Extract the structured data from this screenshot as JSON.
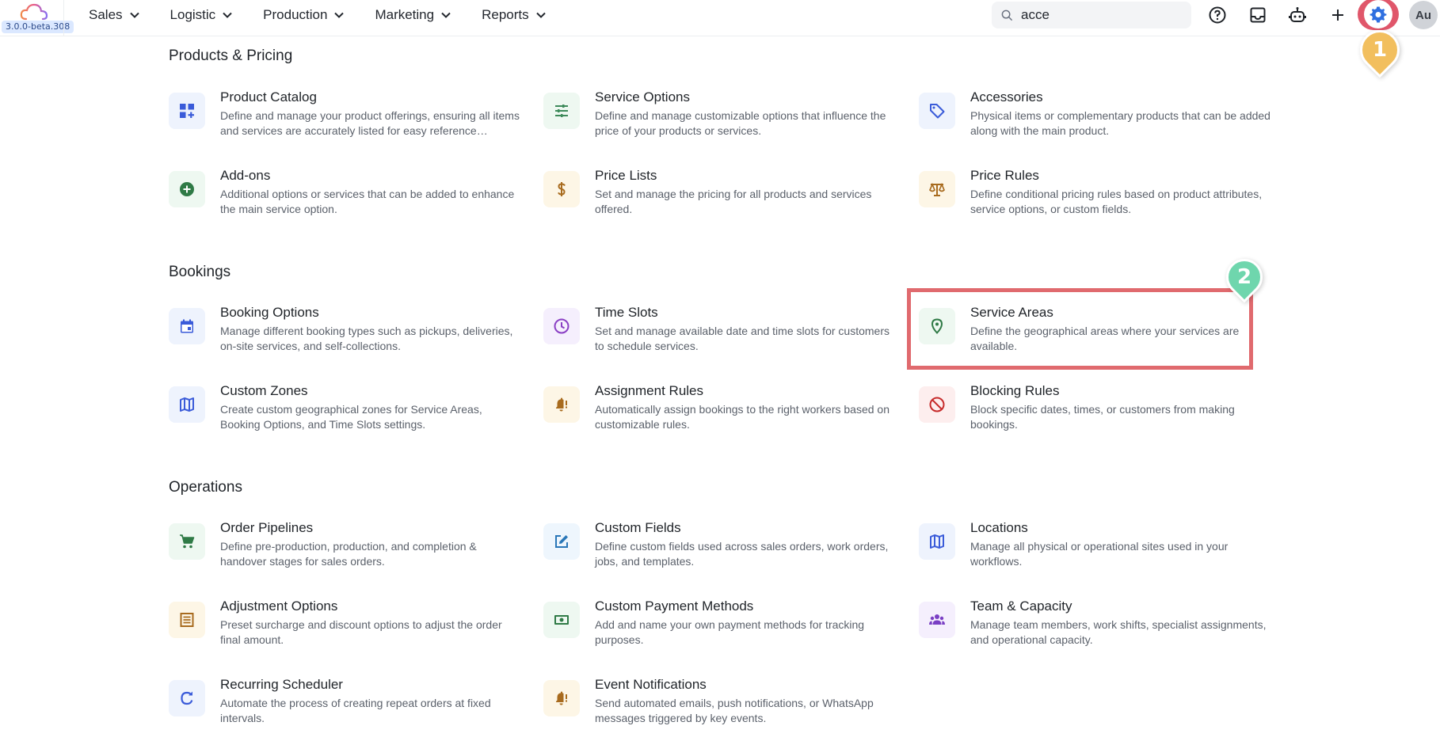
{
  "header": {
    "version": "3.0.0-beta.308",
    "nav": [
      "Sales",
      "Logistic",
      "Production",
      "Marketing",
      "Reports"
    ],
    "search_value": "acce",
    "avatar_initials": "Au",
    "accent": "#2f6fe0"
  },
  "markers": {
    "first": "1",
    "second": "2"
  },
  "sections": [
    {
      "title": "Products & Pricing",
      "cards": [
        {
          "title": "Product Catalog",
          "desc": "Define and manage your product offerings, ensuring all items and services are accurately listed for easy reference…"
        },
        {
          "title": "Service Options",
          "desc": "Define and manage customizable options that influence the price of your products or services."
        },
        {
          "title": "Accessories",
          "desc": "Physical items or complementary products that can be added along with the main product."
        },
        {
          "title": "Add-ons",
          "desc": "Additional options or services that can be added to enhance the main service option."
        },
        {
          "title": "Price Lists",
          "desc": "Set and manage the pricing for all products and services offered."
        },
        {
          "title": "Price Rules",
          "desc": "Define conditional pricing rules based on product attributes, service options, or custom fields."
        }
      ]
    },
    {
      "title": "Bookings",
      "cards": [
        {
          "title": "Booking Options",
          "desc": "Manage different booking types such as pickups, deliveries, on-site services, and self-collections."
        },
        {
          "title": "Time Slots",
          "desc": "Set and manage available date and time slots for customers to schedule services."
        },
        {
          "title": "Service Areas",
          "desc": "Define the geographical areas where your services are available."
        },
        {
          "title": "Custom Zones",
          "desc": "Create custom geographical zones for Service Areas, Booking Options, and Time Slots settings."
        },
        {
          "title": "Assignment Rules",
          "desc": "Automatically assign bookings to the right workers based on customizable rules."
        },
        {
          "title": "Blocking Rules",
          "desc": "Block specific dates, times, or customers from making bookings."
        }
      ]
    },
    {
      "title": "Operations",
      "cards": [
        {
          "title": "Order Pipelines",
          "desc": "Define pre-production, production, and completion & handover stages for sales orders."
        },
        {
          "title": "Custom Fields",
          "desc": "Define custom fields used across sales orders, work orders, jobs, and templates."
        },
        {
          "title": "Locations",
          "desc": "Manage all physical or operational sites used in your workflows."
        },
        {
          "title": "Adjustment Options",
          "desc": "Preset surcharge and discount options to adjust the order final amount."
        },
        {
          "title": "Custom Payment Methods",
          "desc": "Add and name your own payment methods for tracking purposes."
        },
        {
          "title": "Team & Capacity",
          "desc": "Manage team members, work shifts, specialist assignments, and operational capacity."
        },
        {
          "title": "Recurring Scheduler",
          "desc": "Automate the process of creating repeat orders at fixed intervals."
        },
        {
          "title": "Event Notifications",
          "desc": "Send automated emails, push notifications, or WhatsApp messages triggered by key events."
        }
      ]
    }
  ]
}
